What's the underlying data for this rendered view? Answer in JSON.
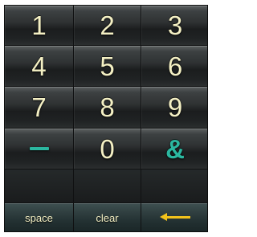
{
  "keypad": {
    "rows": [
      [
        "1",
        "2",
        "3"
      ],
      [
        "4",
        "5",
        "6"
      ],
      [
        "7",
        "8",
        "9"
      ],
      [
        "–",
        "0",
        "&"
      ]
    ],
    "function_keys": {
      "space_label": "space",
      "clear_label": "clear",
      "backspace_icon": "left-arrow-icon"
    }
  },
  "colors": {
    "key_text": "#f4f0c4",
    "accent": "#2bb7a0",
    "arrow": "#f2c21b"
  }
}
